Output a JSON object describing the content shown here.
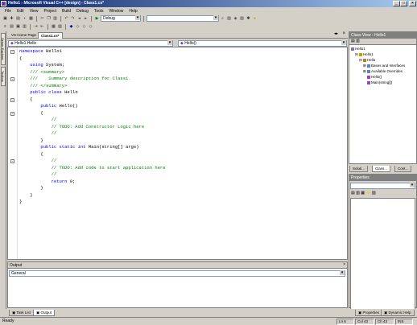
{
  "window": {
    "title": "Hello1 - Microsoft Visual C++ [design] - Class1.cs*",
    "minimize": "_",
    "maximize": "□",
    "close": "×"
  },
  "menu": [
    "File",
    "Edit",
    "View",
    "Project",
    "Build",
    "Debug",
    "Tools",
    "Window",
    "Help"
  ],
  "toolbar": {
    "config_combo": "Debug",
    "search_combo": ""
  },
  "doc_tabs": [
    "VS Home Page",
    "Class1.cs*"
  ],
  "nav": {
    "class_combo": "Hello1.Hello",
    "member_combo": "Hello()"
  },
  "left_tabs": [
    "Server Explorer",
    "Toolbox"
  ],
  "code_lines": [
    [
      {
        "t": "namespace",
        "k": "kw"
      },
      {
        "t": " Hello1"
      }
    ],
    [
      {
        "t": "{"
      }
    ],
    [
      {
        "t": "    "
      },
      {
        "t": "using",
        "k": "kw"
      },
      {
        "t": " System;"
      }
    ],
    [
      {
        "t": ""
      }
    ],
    [
      {
        "t": "    /// <summary>",
        "k": "cm"
      }
    ],
    [
      {
        "t": "    ///    Summary description for Class1.",
        "k": "cm"
      }
    ],
    [
      {
        "t": "    /// </summary>",
        "k": "cm"
      }
    ],
    [
      {
        "t": "    "
      },
      {
        "t": "public class",
        "k": "kw"
      },
      {
        "t": " Hello"
      }
    ],
    [
      {
        "t": "    {"
      }
    ],
    [
      {
        "t": "        "
      },
      {
        "t": "public",
        "k": "kw"
      },
      {
        "t": " Hello()"
      }
    ],
    [
      {
        "t": "        {"
      }
    ],
    [
      {
        "t": "            //",
        "k": "cm"
      }
    ],
    [
      {
        "t": "            // TODO: Add Constructor Logic here",
        "k": "cm"
      }
    ],
    [
      {
        "t": "            //",
        "k": "cm"
      }
    ],
    [
      {
        "t": "        }"
      }
    ],
    [
      {
        "t": ""
      }
    ],
    [
      {
        "t": "        "
      },
      {
        "t": "public static int",
        "k": "kw"
      },
      {
        "t": " Main(string[] args)"
      }
    ],
    [
      {
        "t": "        {"
      }
    ],
    [
      {
        "t": "            //",
        "k": "cm"
      }
    ],
    [
      {
        "t": "            // TODO: Add code to start application here",
        "k": "cm"
      }
    ],
    [
      {
        "t": "            //",
        "k": "cm"
      }
    ],
    [
      {
        "t": "            "
      },
      {
        "t": "return",
        "k": "kw"
      },
      {
        "t": " 0;"
      }
    ],
    [
      {
        "t": "        }"
      }
    ],
    [
      {
        "t": "    }"
      }
    ],
    [
      {
        "t": "}"
      }
    ]
  ],
  "output": {
    "title": "Output",
    "pane": "General"
  },
  "class_view": {
    "title": "Class View - Hello1",
    "items": [
      "Hello1",
      "Hello1",
      "Hello",
      "Bases and Interfaces",
      "Available Overrides",
      "Hello()",
      "Main(string[])"
    ]
  },
  "right_tabs": [
    "Soluti...",
    "Class...",
    "Cont..."
  ],
  "properties": {
    "title": "Properties"
  },
  "bottom_tabs": [
    "Task List",
    "Output"
  ],
  "right_bottom_tabs": [
    "Properties",
    "Dynamic Help"
  ],
  "status": {
    "text": "Ready",
    "ln": "Ln 6",
    "col": "Col 43",
    "ch": "Ch 43",
    "mode": "INS"
  }
}
